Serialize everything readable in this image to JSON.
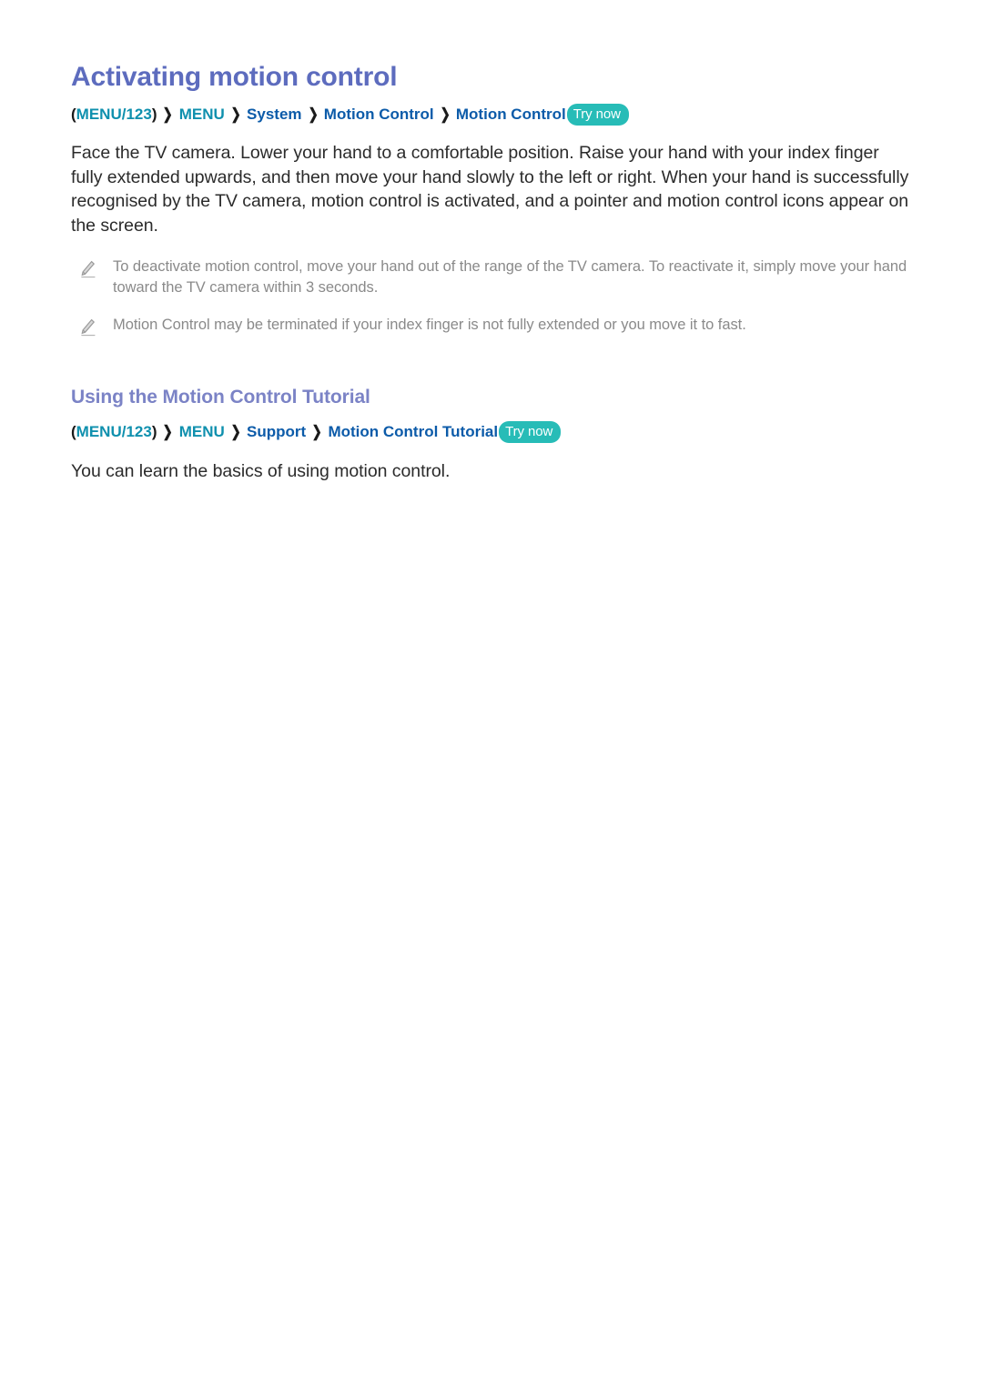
{
  "document": {
    "title": "Activating motion control"
  },
  "sections": [
    {
      "heading": "Activating motion control",
      "breadcrumb": {
        "open_paren": "(",
        "menu123": "MENU/123",
        "close_paren": ")",
        "separator": "❯",
        "items": [
          {
            "label": "MENU",
            "style": "teal"
          },
          {
            "label": "System",
            "style": "blue"
          },
          {
            "label": "Motion Control",
            "style": "blue"
          },
          {
            "label": "Motion Control",
            "style": "blue"
          }
        ],
        "try_now": "Try now"
      },
      "paragraph": "Face the TV camera. Lower your hand to a comfortable position. Raise your hand with your index finger fully extended upwards, and then move your hand slowly to the left or right. When your hand is successfully recognised by the TV camera, motion control is activated, and a pointer and motion control icons appear on the screen.",
      "notes": [
        "To deactivate motion control, move your hand out of the range of the TV camera. To reactivate it, simply move your hand toward the TV camera within 3 seconds.",
        "Motion Control may be terminated if your index finger is not fully extended or you move it to fast."
      ]
    },
    {
      "heading": "Using the Motion Control Tutorial",
      "breadcrumb": {
        "open_paren": "(",
        "menu123": "MENU/123",
        "close_paren": ")",
        "separator": "❯",
        "items": [
          {
            "label": "MENU",
            "style": "teal"
          },
          {
            "label": "Support",
            "style": "blue"
          },
          {
            "label": "Motion Control Tutorial",
            "style": "blue"
          }
        ],
        "try_now": "Try now"
      },
      "paragraph": "You can learn the basics of using motion control."
    }
  ],
  "icons": {
    "note_bullet": "pencil-icon"
  },
  "colors": {
    "page_title": "#5d6cbe",
    "section_title": "#7b83c6",
    "breadcrumb_teal": "#0f90ae",
    "breadcrumb_blue": "#0c5ba9",
    "try_now_badge": "#27bcb7",
    "body_text": "#2b2b2b",
    "note_text": "#8a8a8a",
    "background": "#ffffff"
  }
}
